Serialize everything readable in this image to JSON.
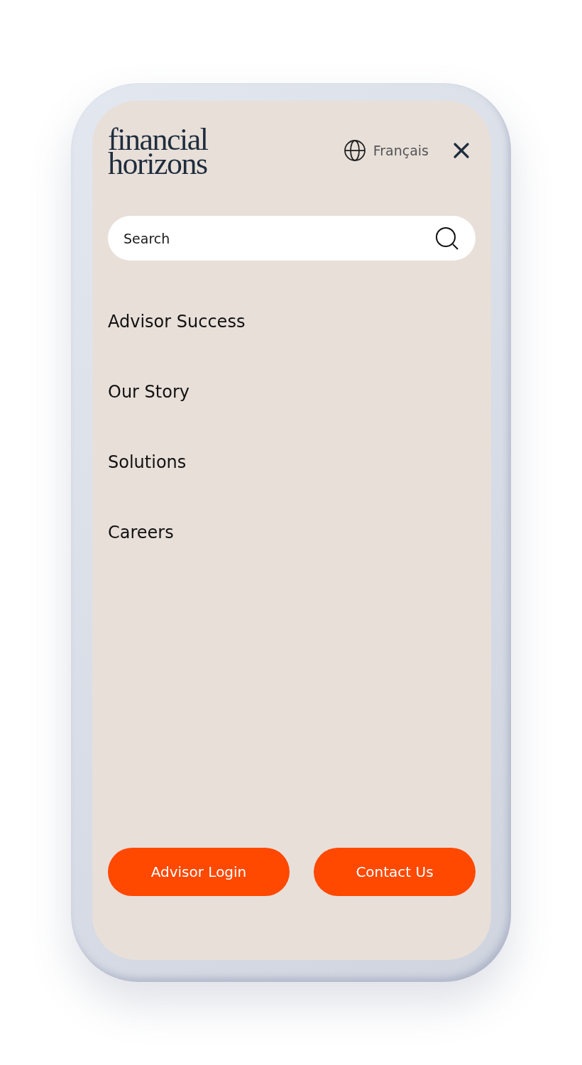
{
  "logo": {
    "lines": [
      "financial",
      "horizons"
    ]
  },
  "language": {
    "label": "Français"
  },
  "search": {
    "placeholder": "Search"
  },
  "menu": [
    {
      "label": "Advisor Success"
    },
    {
      "label": "Our Story"
    },
    {
      "label": "Solutions"
    },
    {
      "label": "Careers"
    }
  ],
  "buttons": [
    {
      "label": "Advisor Login"
    },
    {
      "label": "Contact Us"
    }
  ]
}
